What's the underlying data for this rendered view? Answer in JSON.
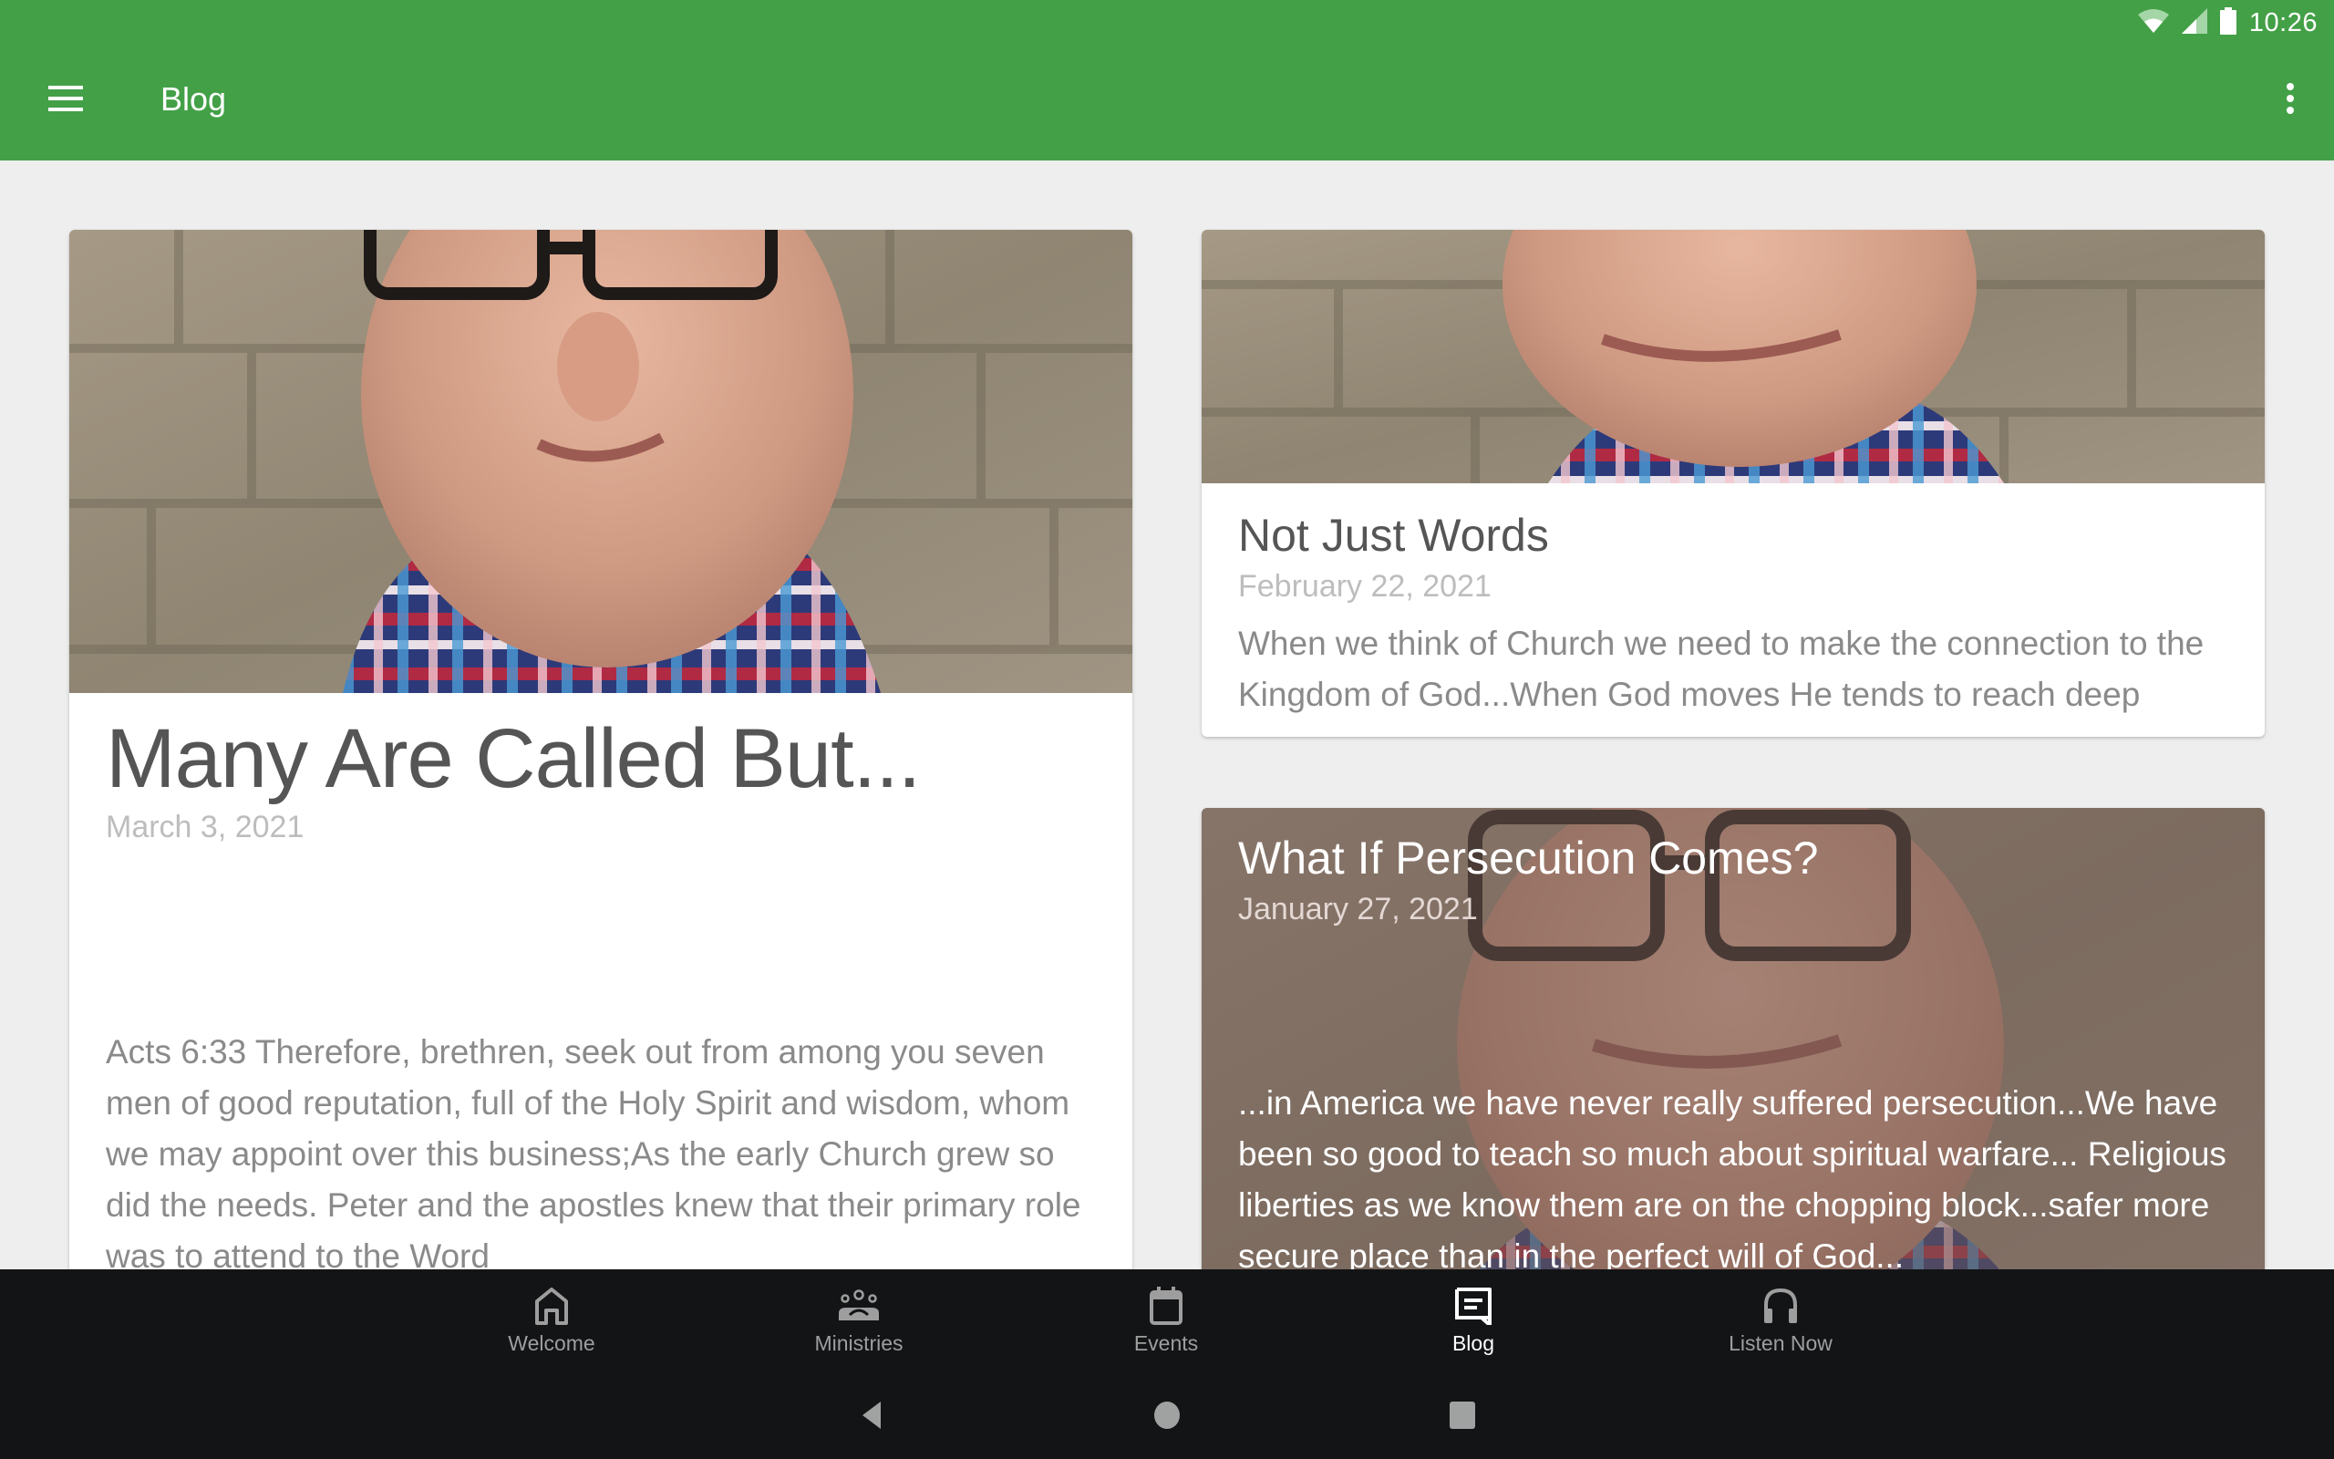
{
  "status_bar": {
    "time": "10:26",
    "icons": [
      "wifi-icon",
      "cell-signal-icon",
      "battery-icon"
    ]
  },
  "app_bar": {
    "title": "Blog",
    "menu_icon": "hamburger-menu-icon",
    "overflow_icon": "more-vert-icon"
  },
  "colors": {
    "primary": "#43a047",
    "background": "#eeeeee",
    "nav_background": "#131416",
    "nav_inactive": "#9e9e9e",
    "nav_active": "#ffffff"
  },
  "posts": [
    {
      "title": "Many Are Called But...",
      "date": "March 3, 2021",
      "excerpt": "Acts 6:33 Therefore, brethren, seek out from among you seven men of good reputation, full of the Holy Spirit and wisdom, whom we may appoint over this business;As the early Church grew so did the needs. Peter and the apostles knew that their primary role was to attend to the Word",
      "image": "author-photo"
    },
    {
      "title": "Not Just Words",
      "date": "February 22, 2021",
      "excerpt": "When we think of Church we need to make the connection to the Kingdom of God...When God moves He tends to reach deep",
      "image": "author-photo"
    },
    {
      "title": "What If Persecution Comes?",
      "date": "January 27, 2021",
      "excerpt": "...in America we have never really suffered persecution...We have been so good to teach so much about spiritual warfare... Religious liberties as we know them are on the chopping block...safer more secure place than in the perfect will of God...",
      "image": "author-photo"
    }
  ],
  "bottom_nav": {
    "items": [
      {
        "label": "Welcome",
        "icon": "home-icon",
        "active": false
      },
      {
        "label": "Ministries",
        "icon": "groups-icon",
        "active": false
      },
      {
        "label": "Events",
        "icon": "calendar-icon",
        "active": false
      },
      {
        "label": "Blog",
        "icon": "blog-chat-icon",
        "active": true
      },
      {
        "label": "Listen Now",
        "icon": "headphones-icon",
        "active": false
      }
    ]
  },
  "system_nav": {
    "buttons": [
      "back-icon",
      "home-circle-icon",
      "recents-icon"
    ]
  }
}
